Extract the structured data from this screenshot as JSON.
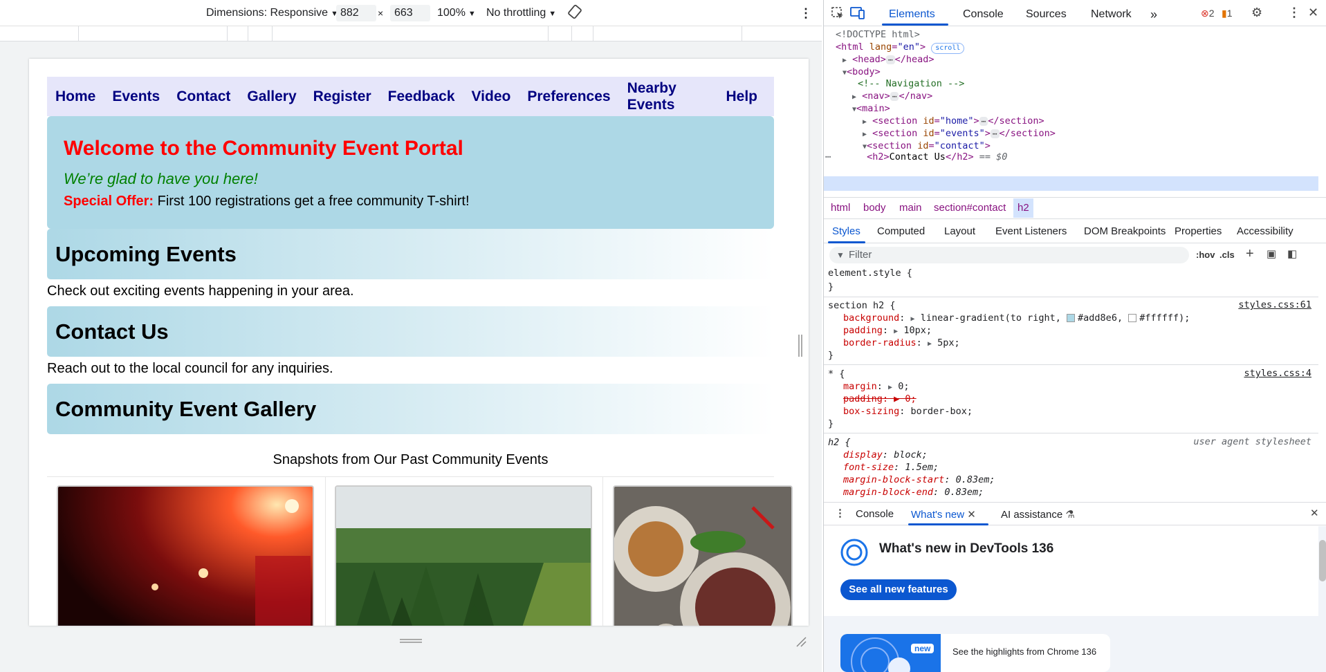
{
  "device_toolbar": {
    "dimensions_label": "Dimensions: Responsive",
    "width": "882",
    "x_sep": "×",
    "height": "663",
    "zoom": "100%",
    "throttling": "No throttling"
  },
  "site": {
    "nav": [
      "Home",
      "Events",
      "Contact",
      "Gallery",
      "Register",
      "Feedback",
      "Video",
      "Preferences",
      "Nearby Events",
      "Help"
    ],
    "welcome_title": "Welcome to the Community Event Portal",
    "welcome_tagline": "We’re glad to have you here!",
    "offer_label": "Special Offer:",
    "offer_text": " First 100 registrations get a free community T-shirt!",
    "sections": [
      {
        "title": "Upcoming Events",
        "text": "Check out exciting events happening in your area."
      },
      {
        "title": "Contact Us",
        "text": "Reach out to the local council for any inquiries."
      },
      {
        "title": "Community Event Gallery",
        "text": ""
      }
    ],
    "gallery_caption": "Snapshots from Our Past Community Events"
  },
  "devtools": {
    "tabs": [
      "Elements",
      "Console",
      "Sources",
      "Network"
    ],
    "more_tabs": "»",
    "errors": "2",
    "warnings": "1",
    "dom": {
      "doctype": "<!DOCTYPE html>",
      "html_open": "<html",
      "html_lang_attr": "lang",
      "html_lang_val": "\"en\"",
      "scroll_badge": "scroll",
      "head": "<head>",
      "head_close": "</head>",
      "body": "<body>",
      "comment": "<!-- Navigation -->",
      "nav": "<nav>",
      "nav_close": "</nav>",
      "main": "<main>",
      "section_home_id": "\"home\"",
      "section_events_id": "\"events\"",
      "section_contact_id": "\"contact\"",
      "section_close": "</section>",
      "h2_open": "<h2>",
      "h2_text": "Contact Us",
      "h2_close": "</h2>",
      "dollar0": "== $0"
    },
    "breadcrumbs": [
      "html",
      "body",
      "main",
      "section#contact",
      "h2"
    ],
    "subtabs": [
      "Styles",
      "Computed",
      "Layout",
      "Event Listeners",
      "DOM Breakpoints",
      "Properties",
      "Accessibility"
    ],
    "filter_placeholder": "Filter",
    "hov": ":hov",
    "cls": ".cls",
    "styles": {
      "element_style": "element.style {",
      "close_brace": "}",
      "rule1_selector": "section h2 {",
      "rule1_source": "styles.css:61",
      "rule1_bg_prop": "background",
      "rule1_bg_val_a": "linear-gradient(to right, ",
      "rule1_bg_c1": "#add8e6",
      "rule1_bg_c2": "#ffffff",
      "rule1_bg_end": ");",
      "rule1_padding_prop": "padding",
      "rule1_padding_val": "10px;",
      "rule1_radius_prop": "border-radius",
      "rule1_radius_val": "5px;",
      "rule2_selector": "* {",
      "rule2_source": "styles.css:4",
      "rule2_margin_prop": "margin",
      "rule2_margin_val": "0;",
      "rule2_padding_prop": "padding",
      "rule2_padding_val": "0;",
      "rule2_box_prop": "box-sizing",
      "rule2_box_val": "border-box;",
      "rule3_selector": "h2 {",
      "rule3_source": "user agent stylesheet",
      "rule3_display_prop": "display",
      "rule3_display_val": "block;",
      "rule3_font_prop": "font-size",
      "rule3_font_val": "1.5em;",
      "rule3_mbs_prop": "margin-block-start",
      "rule3_mbs_val": "0.83em;",
      "rule3_mbe_prop": "margin-block-end",
      "rule3_mbe_val": "0.83em;"
    },
    "drawer_tabs": [
      "Console",
      "What's new",
      "AI assistance"
    ],
    "whats_new_title": "What's new in DevTools 136",
    "see_all_button": "See all new features",
    "new_badge": "new",
    "highlights": "See the highlights from Chrome 136"
  },
  "colors": {
    "accent": "#0b57d0",
    "nav_bg": "#e6e6fa",
    "nav_link": "#000080",
    "welcome_bg": "#add8e6",
    "title_red": "#ff0000",
    "tagline_green": "#008000"
  }
}
